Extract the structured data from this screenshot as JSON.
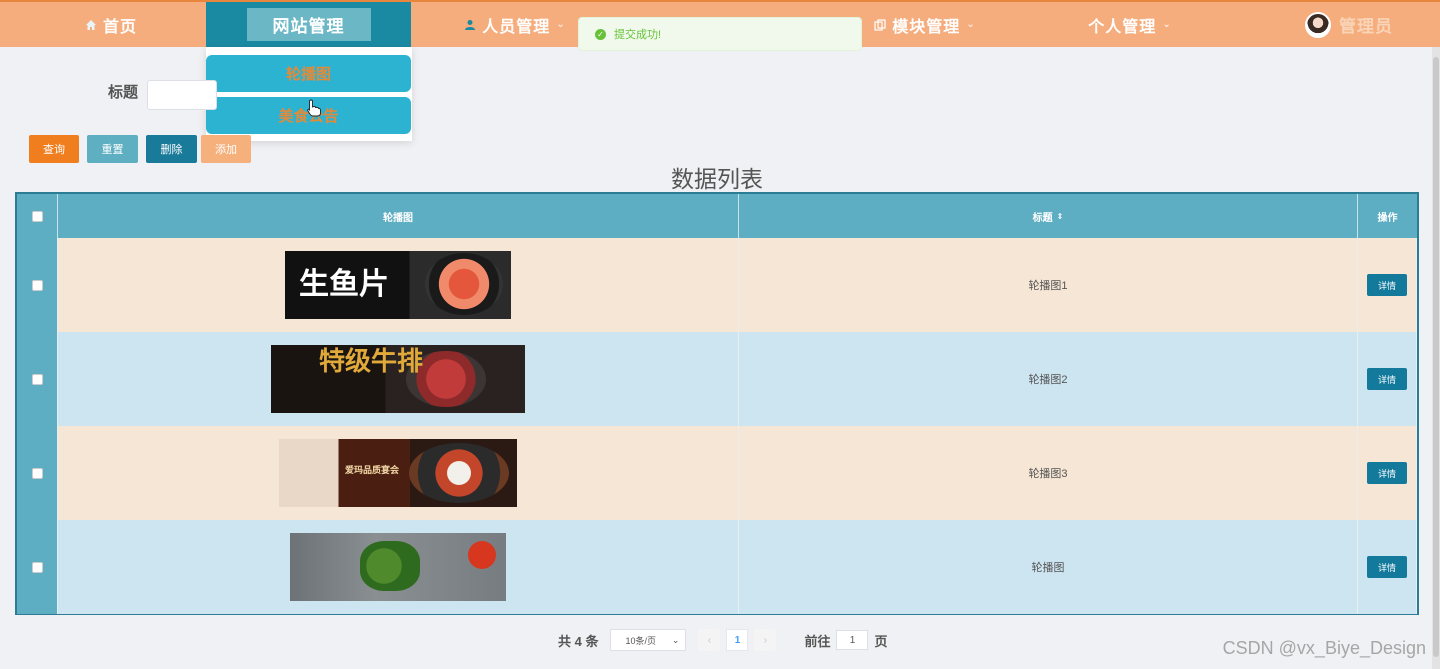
{
  "nav": {
    "home": "首页",
    "site": "网站管理",
    "people": "人员管理",
    "module": "模块管理",
    "personal": "个人管理",
    "user": "管理员"
  },
  "toast": {
    "message": "提交成功!"
  },
  "dropdown": {
    "items": [
      "轮播图",
      "美食公告"
    ]
  },
  "search": {
    "label": "标题",
    "placeholder": ""
  },
  "buttons": {
    "query": "查询",
    "reset": "重置",
    "delete": "删除",
    "add": "添加"
  },
  "list_title": "数据列表",
  "table": {
    "headers": {
      "image": "轮播图",
      "title": "标题",
      "op": "操作"
    },
    "rows": [
      {
        "title": "轮播图1",
        "image_text": "生鱼片",
        "detail": "详情"
      },
      {
        "title": "轮播图2",
        "image_text": "特级牛排",
        "detail": "详情"
      },
      {
        "title": "轮播图3",
        "image_text": "爱玛品质宴会",
        "detail": "详情"
      },
      {
        "title": "轮播图",
        "image_text": "",
        "detail": "详情"
      }
    ]
  },
  "pagination": {
    "total": "共 4 条",
    "page_size": "10条/页",
    "current": "1",
    "goto_label": "前往",
    "goto_value": "1",
    "page_suffix": "页"
  },
  "watermark": "CSDN @vx_Biye_Design",
  "colors": {
    "nav_bg": "#f5ad7e",
    "nav_active": "#1a8aa3",
    "header_bg": "#5eaec3",
    "row_a": "#f5e6d5",
    "row_b": "#cde4f1",
    "detail_btn": "#137a9c"
  }
}
